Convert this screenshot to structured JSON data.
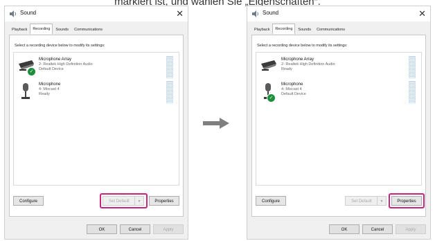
{
  "caption": "markiert ist, und wählen Sie „Eigenschaften“.",
  "dialogs": [
    {
      "title": "Sound",
      "tabs": [
        "Playback",
        "Recording",
        "Sounds",
        "Communications"
      ],
      "active_tab": "Recording",
      "instruction": "Select a recording device below to modify its settings:",
      "devices": [
        {
          "name": "Microphone Array",
          "desc": "2- Realtek High Definition Audio",
          "status": "Default Device",
          "default": true
        },
        {
          "name": "Microphone",
          "desc": "4- Mixcast 4",
          "status": "Ready",
          "default": false
        }
      ],
      "buttons": {
        "configure": "Configure",
        "set_default": "Set Default",
        "properties": "Properties",
        "ok": "OK",
        "cancel": "Cancel",
        "apply": "Apply"
      },
      "highlight": "set_default"
    },
    {
      "title": "Sound",
      "tabs": [
        "Playback",
        "Recording",
        "Sounds",
        "Communications"
      ],
      "active_tab": "Recording",
      "instruction": "Select a recording device below to modify its settings:",
      "devices": [
        {
          "name": "Microphone Array",
          "desc": "2- Realtek High Definition Audio",
          "status": "Ready",
          "default": false
        },
        {
          "name": "Microphone",
          "desc": "4- Mixcast 4",
          "status": "Default Device",
          "default": true
        }
      ],
      "buttons": {
        "configure": "Configure",
        "set_default": "Set Default",
        "properties": "Properties",
        "ok": "OK",
        "cancel": "Cancel",
        "apply": "Apply"
      },
      "highlight": "properties"
    }
  ],
  "colors": {
    "highlight": "#c8247e",
    "default_badge": "#1e8d3c",
    "arrow": "#7f7f7f"
  },
  "icons": {
    "title": "speaker-icon",
    "close": "close-icon",
    "arrow": "right-arrow-icon",
    "badge": "check-badge-icon"
  }
}
